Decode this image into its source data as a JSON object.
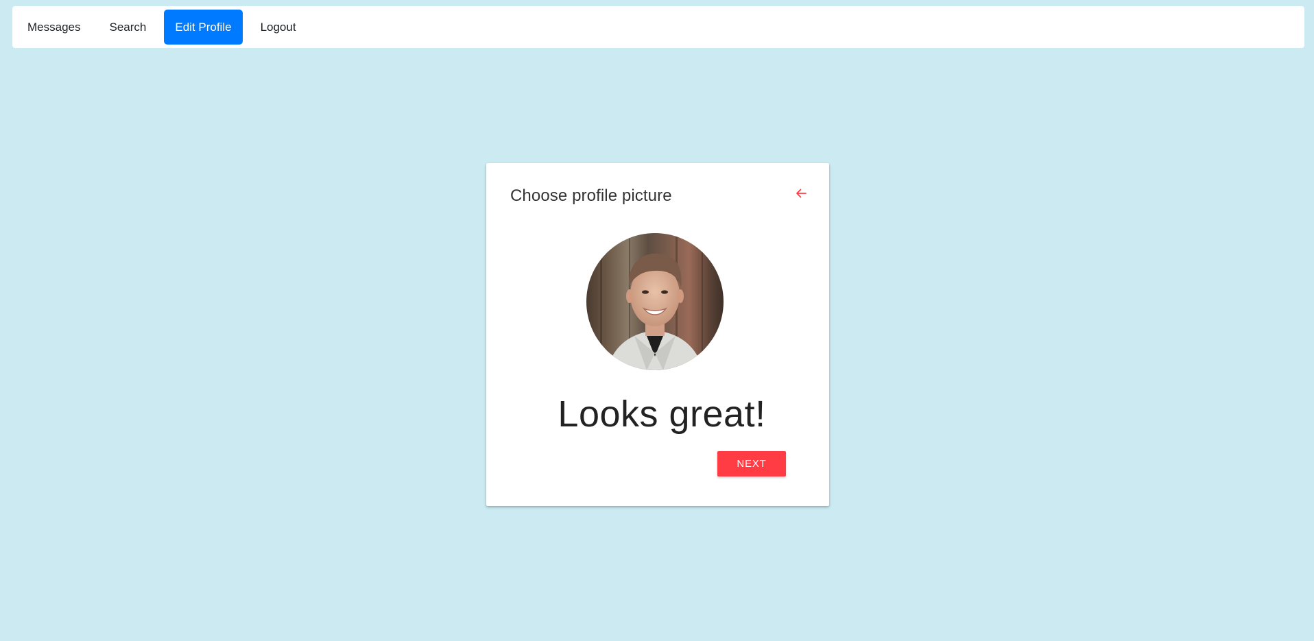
{
  "nav": {
    "items": [
      {
        "label": "Messages",
        "active": false
      },
      {
        "label": "Search",
        "active": false
      },
      {
        "label": "Edit Profile",
        "active": true
      },
      {
        "label": "Logout",
        "active": false
      }
    ]
  },
  "card": {
    "title": "Choose profile picture",
    "back_icon": "arrow-left-icon",
    "headline": "Looks great!",
    "next_label": "NEXT",
    "avatar_alt": "profile photo"
  },
  "colors": {
    "background": "#cbeaf1",
    "nav_active": "#007bff",
    "accent_red": "#ff3b44"
  }
}
